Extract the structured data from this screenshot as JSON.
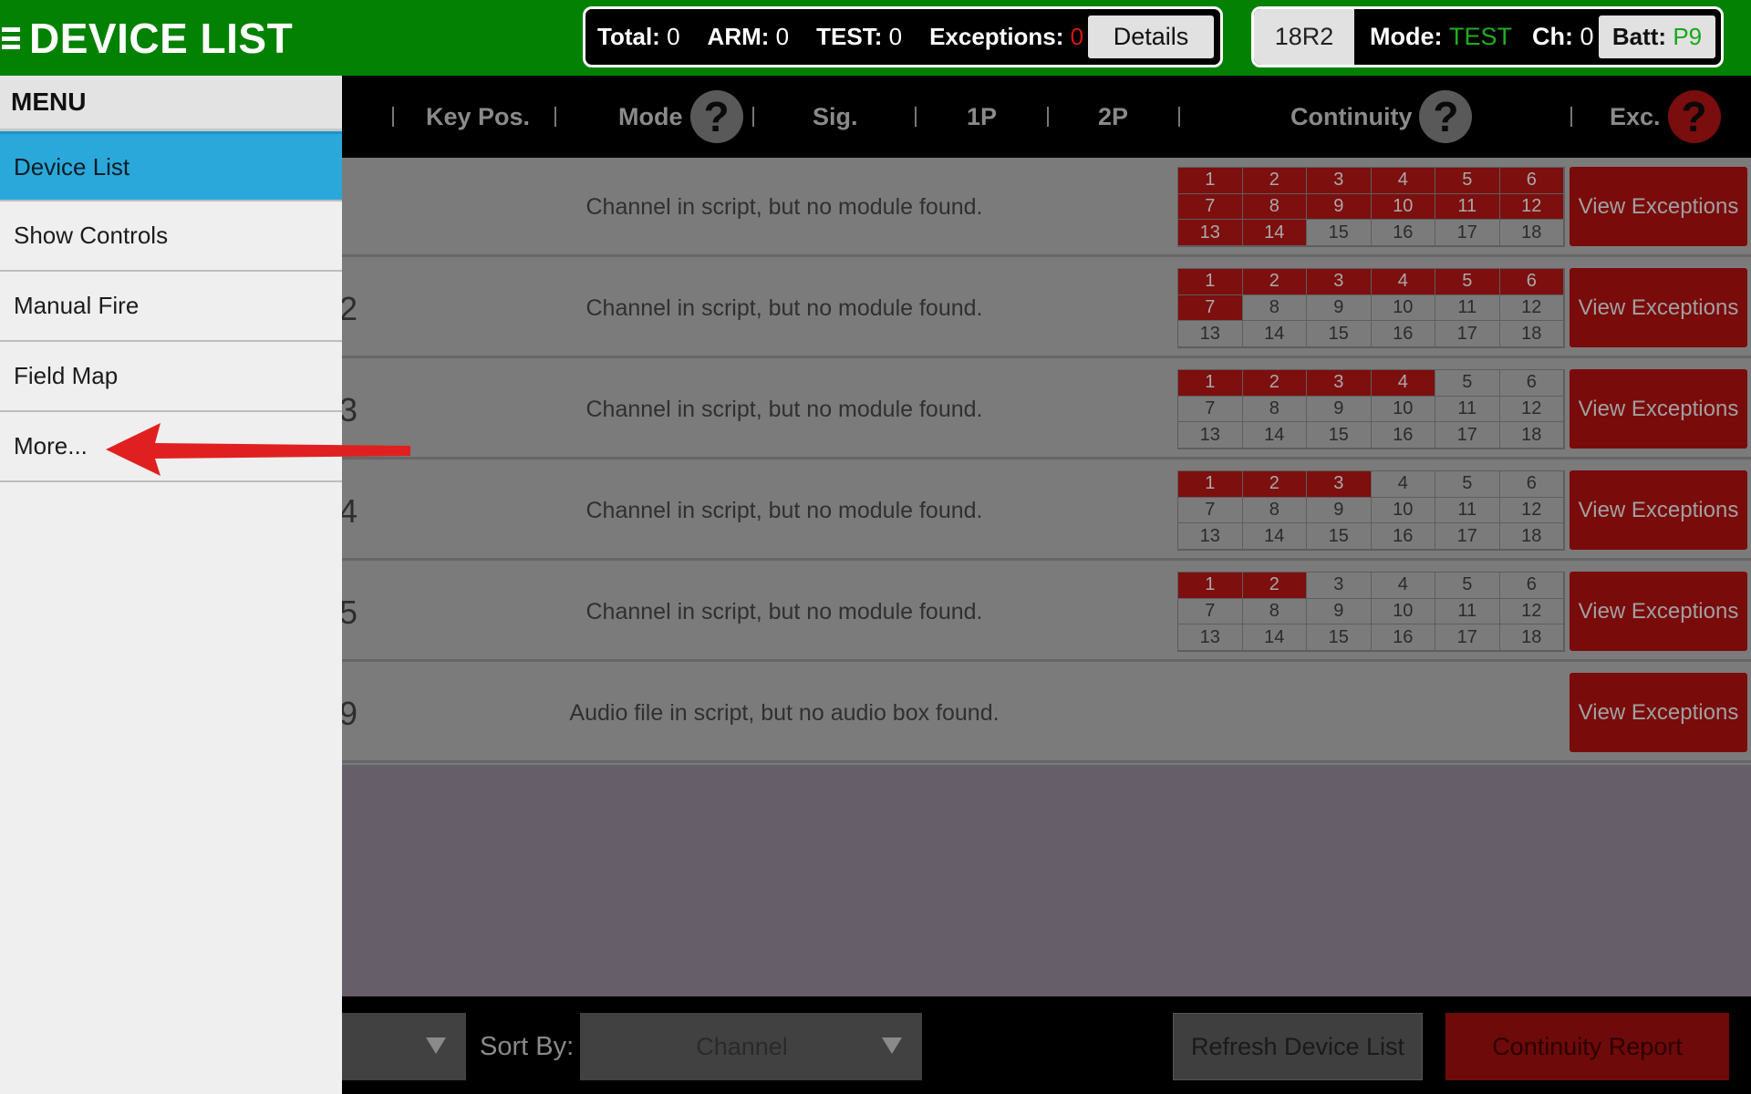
{
  "header": {
    "title": "DEVICE LIST",
    "stats": {
      "total_label": "Total:",
      "total_value": "0",
      "arm_label": "ARM:",
      "arm_value": "0",
      "test_label": "TEST:",
      "test_value": "0",
      "exceptions_label": "Exceptions:",
      "exceptions_value": "0"
    },
    "details_label": "Details",
    "device": {
      "id": "18R2",
      "mode_label": "Mode:",
      "mode_value": "TEST",
      "ch_label": "Ch:",
      "ch_value": "0",
      "batt_label": "Batt:",
      "batt_value": "P9"
    }
  },
  "columns": {
    "key_pos": "Key Pos.",
    "mode": "Mode",
    "sig": "Sig.",
    "one_p": "1P",
    "two_p": "2P",
    "continuity": "Continuity",
    "exc": "Exc.",
    "help_glyph": "?"
  },
  "rows": [
    {
      "num": "",
      "message": "Channel in script, but no module found.",
      "exc_label": "View Exceptions",
      "active_cells": 14
    },
    {
      "num": "2",
      "message": "Channel in script, but no module found.",
      "exc_label": "View Exceptions",
      "active_cells": 7
    },
    {
      "num": "3",
      "message": "Channel in script, but no module found.",
      "exc_label": "View Exceptions",
      "active_cells": 4
    },
    {
      "num": "4",
      "message": "Channel in script, but no module found.",
      "exc_label": "View Exceptions",
      "active_cells": 3
    },
    {
      "num": "5",
      "message": "Channel in script, but no module found.",
      "exc_label": "View Exceptions",
      "active_cells": 2
    },
    {
      "num": "9",
      "message": "Audio file in script, but no audio box found.",
      "exc_label": "View Exceptions",
      "active_cells": 0
    }
  ],
  "continuity_cells": [
    "1",
    "2",
    "3",
    "4",
    "5",
    "6",
    "7",
    "8",
    "9",
    "10",
    "11",
    "12",
    "13",
    "14",
    "15",
    "16",
    "17",
    "18"
  ],
  "footer": {
    "sort_label": "Sort By:",
    "sort_value": "Channel",
    "refresh_label": "Refresh Device List",
    "report_label": "Continuity Report"
  },
  "menu": {
    "header": "MENU",
    "items": [
      {
        "label": "Device List",
        "active": true
      },
      {
        "label": "Show Controls",
        "active": false
      },
      {
        "label": "Manual Fire",
        "active": false
      },
      {
        "label": "Field Map",
        "active": false
      },
      {
        "label": "More...",
        "active": false
      }
    ]
  },
  "colors": {
    "brand_green": "#038103",
    "menu_active": "#2ba8da",
    "exception_red": "#d81515",
    "annotation_arrow": "#e02020"
  }
}
